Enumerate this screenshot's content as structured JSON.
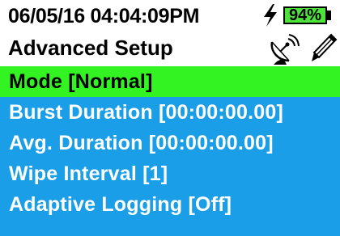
{
  "status": {
    "datetime": "06/05/16  04:04:09PM",
    "battery_percent": "94%",
    "charging_icon": "lightning-bolt-icon"
  },
  "header": {
    "title": "Advanced Setup",
    "icons": [
      "satellite-dish-icon",
      "pen-icon"
    ]
  },
  "menu": {
    "items": [
      {
        "label": "Mode [Normal]",
        "selected": true
      },
      {
        "label": "Burst Duration [00:00:00.00]",
        "selected": false
      },
      {
        "label": "Avg. Duration [00:00:00.00]",
        "selected": false
      },
      {
        "label": "Wipe Interval [1]",
        "selected": false
      },
      {
        "label": "Adaptive Logging [Off]",
        "selected": false
      }
    ]
  },
  "colors": {
    "menu_background": "#1a9ee7",
    "selected_background": "#33f322",
    "battery_fill": "#4ee33b"
  }
}
